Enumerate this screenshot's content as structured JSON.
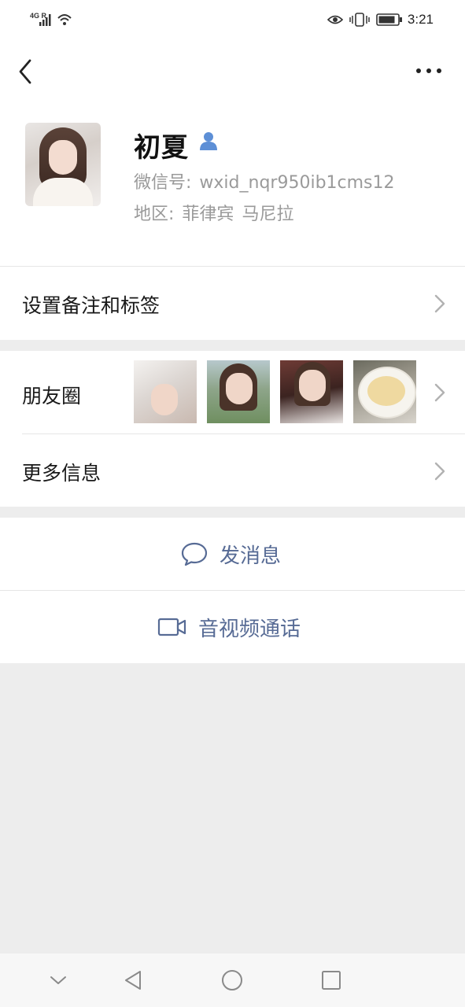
{
  "status_bar": {
    "network": "4G R",
    "time": "3:21"
  },
  "nav": {
    "back_icon": "chevron-left-icon",
    "more_icon": "ellipsis-icon"
  },
  "profile": {
    "name": "初夏",
    "wxid_label": "微信号:",
    "wxid_value": "wxid_nqr950ib1cms12",
    "region_label": "地区:",
    "region_country": "菲律宾",
    "region_city": "马尼拉",
    "gender_icon": "person-icon",
    "gender_color": "#5d8fd6"
  },
  "rows": {
    "remark_label": "设置备注和标签",
    "moments_label": "朋友圈",
    "more_info_label": "更多信息"
  },
  "actions": {
    "message_label": "发消息",
    "message_icon": "chat-bubble-icon",
    "call_label": "音视频通话",
    "call_icon": "video-camera-icon",
    "accent_color": "#576b95"
  },
  "system_nav": {
    "icons": [
      "collapse-icon",
      "back-triangle-icon",
      "home-circle-icon",
      "recents-square-icon"
    ]
  }
}
